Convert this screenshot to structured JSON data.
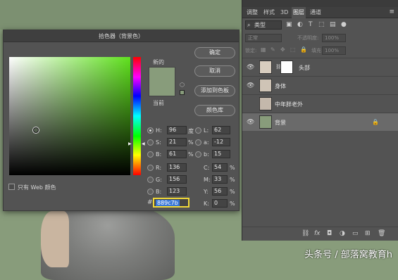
{
  "dialog": {
    "title": "拾色器（背景色）",
    "new_label": "新的",
    "current_label": "当前",
    "buttons": {
      "ok": "确定",
      "cancel": "取消",
      "add_swatch": "添加到色板",
      "color_libraries": "颜色库"
    },
    "only_web_colors": "只有 Web 颜色",
    "fields": {
      "H": {
        "label": "H:",
        "value": "96",
        "unit": "度"
      },
      "S": {
        "label": "S:",
        "value": "21",
        "unit": "%"
      },
      "B": {
        "label": "B:",
        "value": "61",
        "unit": "%"
      },
      "R": {
        "label": "R:",
        "value": "136"
      },
      "G": {
        "label": "G:",
        "value": "156"
      },
      "Bb": {
        "label": "B:",
        "value": "123"
      },
      "L": {
        "label": "L:",
        "value": "62"
      },
      "a": {
        "label": "a:",
        "value": "-12"
      },
      "b": {
        "label": "b:",
        "value": "15"
      },
      "C": {
        "label": "C:",
        "value": "54",
        "unit": "%"
      },
      "M": {
        "label": "M:",
        "value": "33",
        "unit": "%"
      },
      "Y": {
        "label": "Y:",
        "value": "56",
        "unit": "%"
      },
      "K": {
        "label": "K:",
        "value": "0",
        "unit": "%"
      }
    },
    "hash": "#",
    "hex": "889c7b",
    "selected_color": "#889c7b"
  },
  "panel": {
    "tabs": [
      "调整",
      "样式",
      "3D",
      "图层",
      "通道"
    ],
    "active_tab": "图层",
    "kind": "类型",
    "blend_mode": "正常",
    "opacity_label": "不透明度:",
    "opacity_value": "100%",
    "lock_label": "锁定:",
    "fill_label": "填充:",
    "fill_value": "100%",
    "layers": [
      {
        "name": "头部",
        "visible": true
      },
      {
        "name": "身体",
        "visible": true
      },
      {
        "name": "中年胖老外",
        "visible": false
      },
      {
        "name": "背景",
        "visible": true,
        "locked": true
      }
    ]
  },
  "watermark": "头条号 / 部落窝教育h"
}
